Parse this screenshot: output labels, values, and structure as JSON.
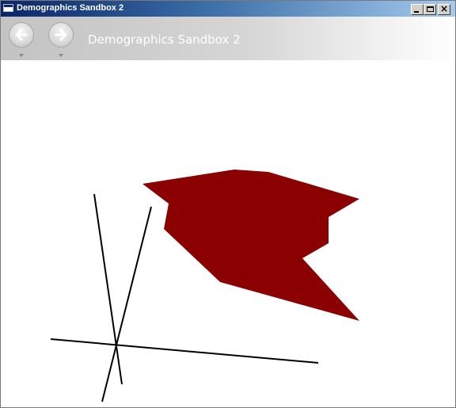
{
  "window": {
    "title": "Demographics Sandbox 2",
    "buttons": {
      "minimize": "minimize",
      "maximize": "maximize",
      "close": "×"
    }
  },
  "navigation": {
    "back_icon": "back-arrow-icon",
    "forward_icon": "forward-arrow-icon",
    "page_title": "Demographics Sandbox 2"
  },
  "scene": {
    "shape_color": "#8b0000",
    "axis_color": "#000000",
    "navbar_title_color": "#ffffff"
  }
}
